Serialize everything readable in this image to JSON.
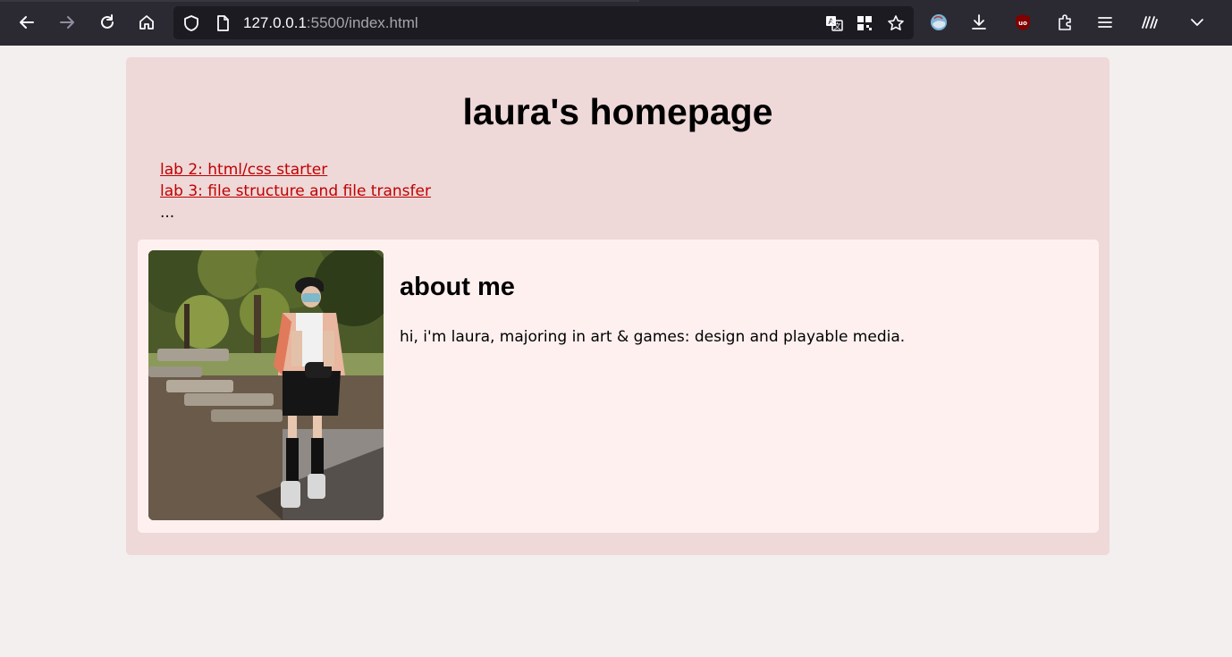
{
  "browser": {
    "url_host": "127.0.0.1",
    "url_path": ":5500/index.html",
    "toolbar_icons": [
      "back-icon",
      "forward-icon",
      "reload-icon",
      "home-icon",
      "shield-icon",
      "page-icon",
      "translate-icon",
      "qr-code-icon",
      "bookmark-star-icon",
      "profile-icon",
      "download-icon",
      "ublock-icon",
      "extensions-icon",
      "menu-icon",
      "reader-icon",
      "chevron-down-icon"
    ]
  },
  "page": {
    "title": "laura's homepage",
    "links": [
      {
        "label": "lab 2: html/css starter"
      },
      {
        "label": "lab 3: file structure and file transfer"
      }
    ],
    "ellipsis": "...",
    "about": {
      "heading": "about me",
      "text": "hi, i'm laura, majoring in art & games: design and playable media."
    }
  },
  "colors": {
    "page_bg": "#f3efee",
    "container_bg": "#eed8d8",
    "card_bg": "#fff0f0",
    "link": "#c00000",
    "toolbar_bg": "#2b2a33"
  }
}
